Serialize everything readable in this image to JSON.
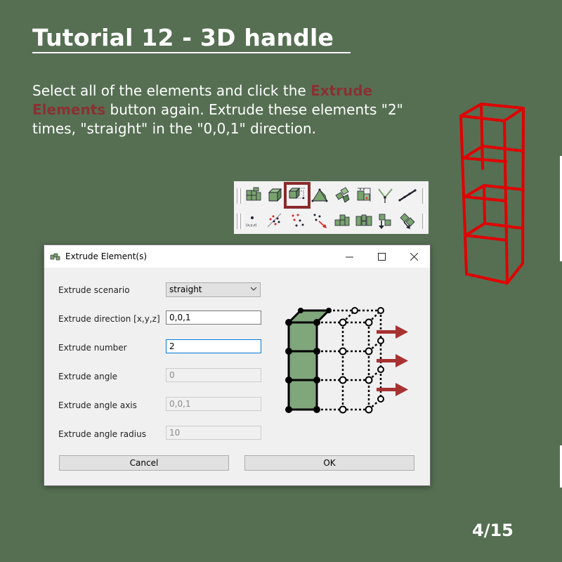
{
  "slide": {
    "title": "Tutorial 12 - 3D handle",
    "instructions": {
      "part1": "Select all of the elements and click the ",
      "highlight": "Extrude Elements",
      "part2": " button again. Extrude these elements \"2\" times, \"straight\" in the \"0,0,1\" direction."
    },
    "page_number": "4/15",
    "colors": {
      "background": "#566f53",
      "highlight_text": "#8a3131",
      "wireframe": "#e00000",
      "arrow": "#a83232",
      "element_fill": "#80a67c"
    }
  },
  "toolbar": {
    "row1": [
      {
        "icon": "block-elements-icon"
      },
      {
        "icon": "cube-element-icon"
      },
      {
        "icon": "extrude-elements-icon",
        "highlighted": true
      },
      {
        "icon": "triangle-element-icon"
      },
      {
        "icon": "rotate-elements-icon"
      },
      {
        "icon": "scale-element-icon"
      },
      {
        "icon": "split-line-icon"
      },
      {
        "icon": "chain-line-icon"
      }
    ],
    "row2": [
      {
        "icon": "node-coordinate-icon"
      },
      {
        "icon": "mirror-nodes-icon"
      },
      {
        "icon": "scatter-nodes-icon"
      },
      {
        "icon": "move-nodes-icon"
      },
      {
        "icon": "group-elements-icon"
      },
      {
        "icon": "split-elements-icon"
      },
      {
        "icon": "down-arrow-elements-icon"
      },
      {
        "icon": "diagonal-arrow-elements-icon"
      }
    ]
  },
  "dialog": {
    "title": "Extrude Element(s)",
    "fields": {
      "scenario": {
        "label": "Extrude scenario",
        "value": "straight"
      },
      "direction": {
        "label": "Extrude direction [x,y,z]",
        "value": "0,0,1"
      },
      "number": {
        "label": "Extrude number",
        "value": "2"
      },
      "angle": {
        "label": "Extrude angle",
        "value": "0"
      },
      "angle_axis": {
        "label": "Extrude angle axis",
        "value": "0,0,1"
      },
      "angle_radius": {
        "label": "Extrude angle radius",
        "value": "10"
      }
    },
    "cancel_label": "Cancel",
    "ok_label": "OK"
  }
}
